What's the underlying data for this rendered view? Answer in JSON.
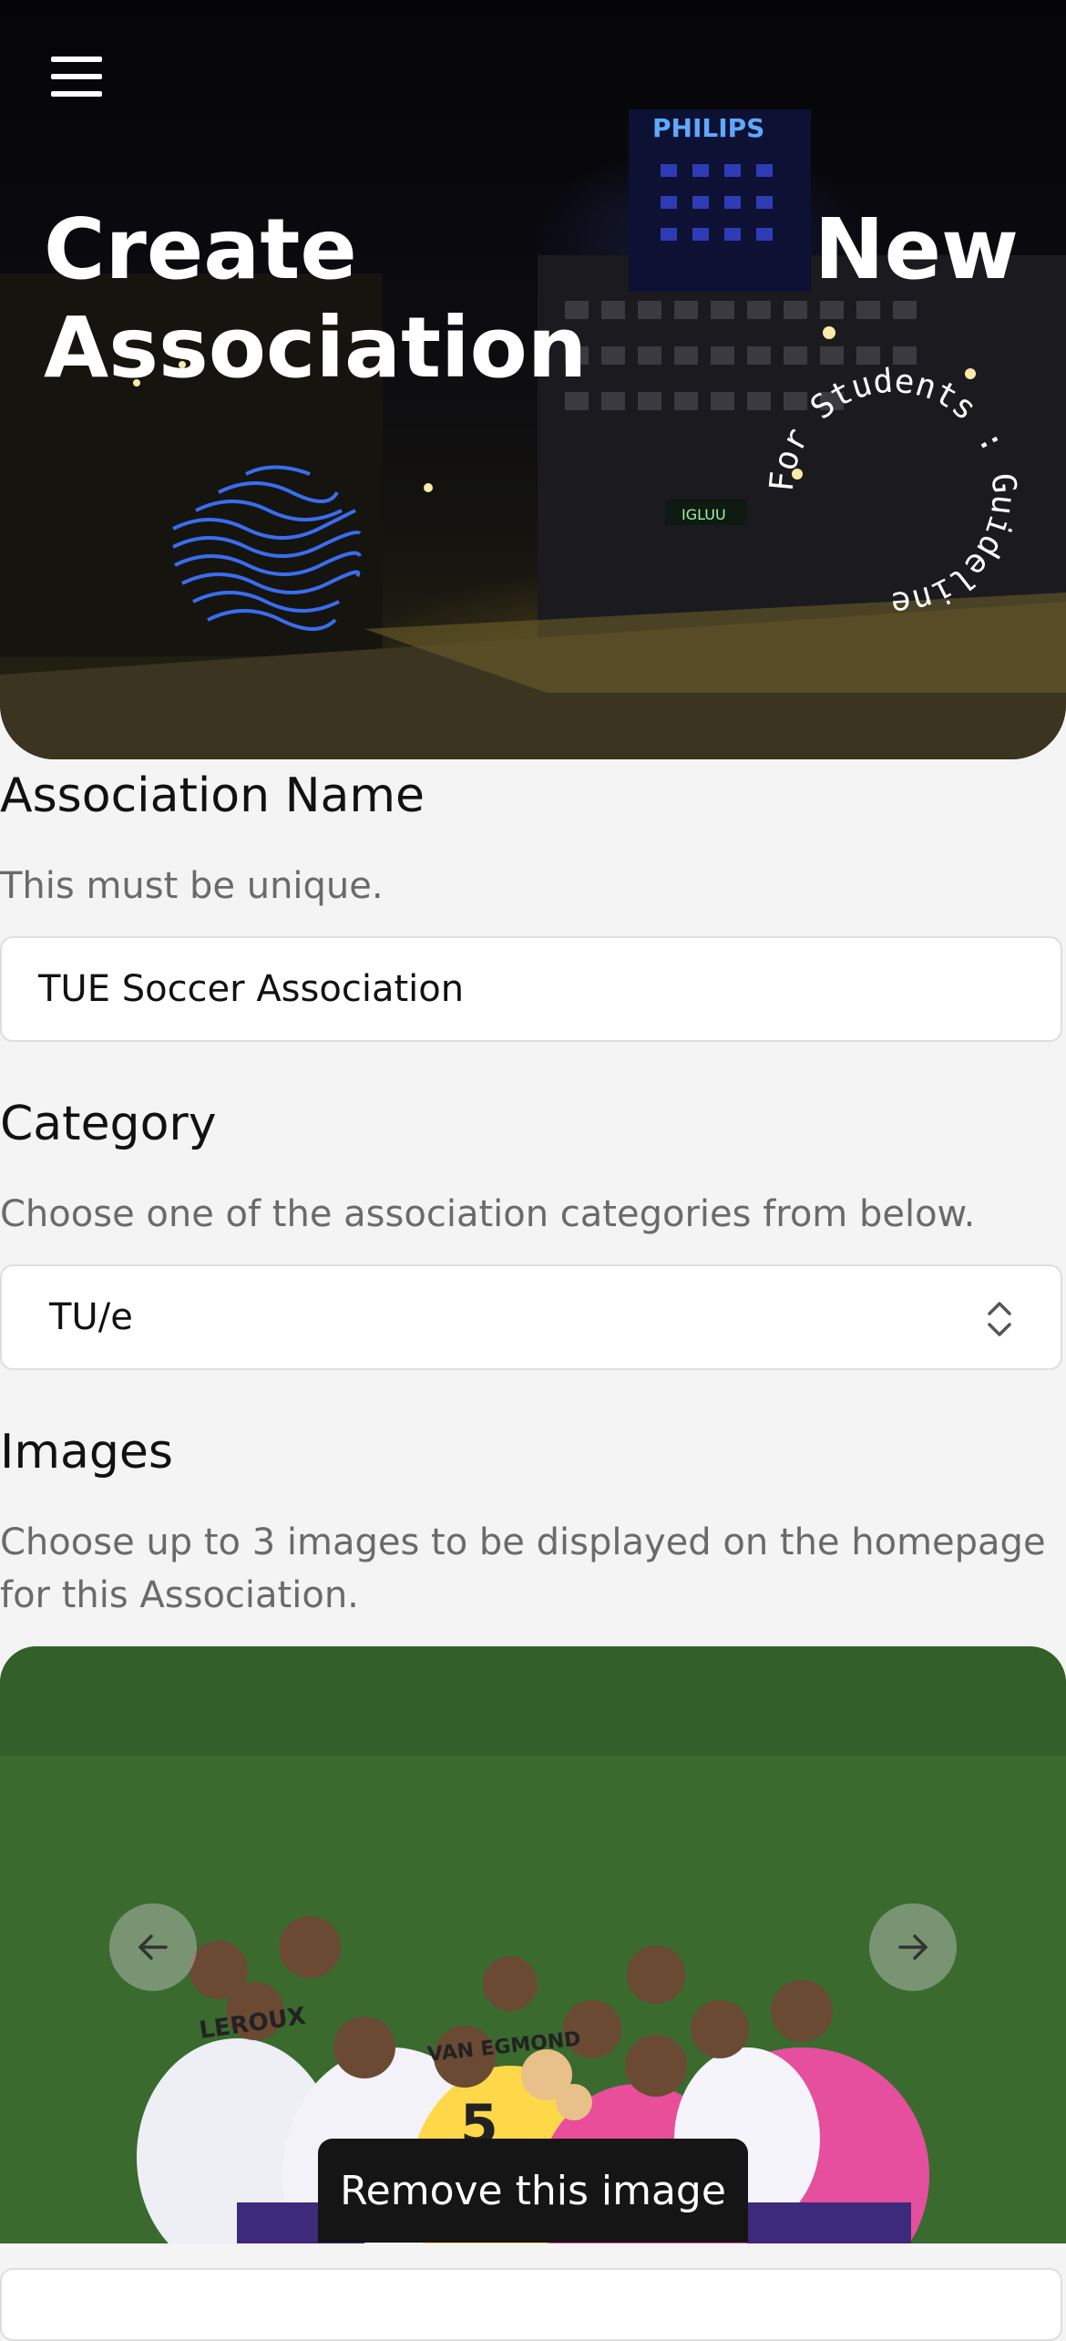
{
  "hero": {
    "title_word_1": "Create",
    "title_word_2": "New",
    "title_word_3": "Association",
    "circular_text": "For Students : Guideline",
    "building_sign": "PHILIPS",
    "store_sign": "IGLUU"
  },
  "menu": {
    "icon": "hamburger-menu-icon"
  },
  "association_name": {
    "label": "Association Name",
    "description": "This must be unique.",
    "value": "TUE Soccer Association"
  },
  "category": {
    "label": "Category",
    "description": "Choose one of the association categories from below.",
    "selected": "TU/e",
    "icon": "chevron-up-down-icon"
  },
  "images": {
    "label": "Images",
    "description": "Choose up to 3 images to be displayed on the homepage for this Association.",
    "prev_icon": "arrow-left-icon",
    "next_icon": "arrow-right-icon",
    "remove_label": "Remove this image",
    "jersey_names": [
      "LEROUX",
      "VAN EGMOND"
    ]
  },
  "colors": {
    "background": "#f4f4f4",
    "accent_blue": "#3a6df0",
    "remove_button": "#151515",
    "field_border": "#dedede"
  }
}
